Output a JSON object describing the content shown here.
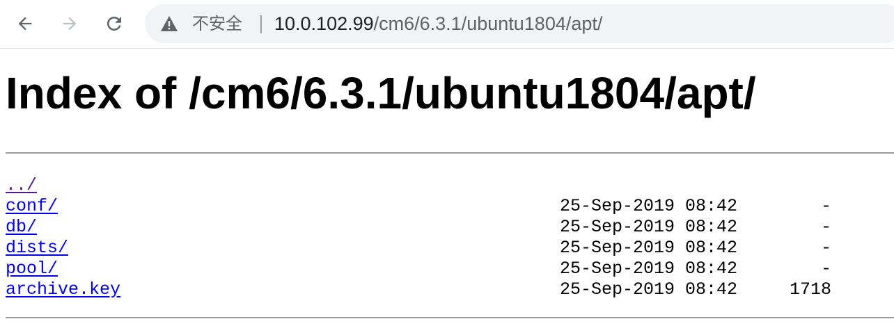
{
  "browser": {
    "security_label": "不安全",
    "url_host": "10.0.102.99",
    "url_path": "/cm6/6.3.1/ubuntu1804/apt/"
  },
  "page": {
    "title": "Index of /cm6/6.3.1/ubuntu1804/apt/",
    "parent_link": "../",
    "entries": [
      {
        "name": "conf/",
        "date": "25-Sep-2019 08:42",
        "size": "-"
      },
      {
        "name": "db/",
        "date": "25-Sep-2019 08:42",
        "size": "-"
      },
      {
        "name": "dists/",
        "date": "25-Sep-2019 08:42",
        "size": "-"
      },
      {
        "name": "pool/",
        "date": "25-Sep-2019 08:42",
        "size": "-"
      },
      {
        "name": "archive.key",
        "date": "25-Sep-2019 08:42",
        "size": "1718"
      }
    ]
  },
  "colors": {
    "link": "#0000ee",
    "visited_link": "#551a8b",
    "omnibox_bg": "#f1f3f4"
  }
}
